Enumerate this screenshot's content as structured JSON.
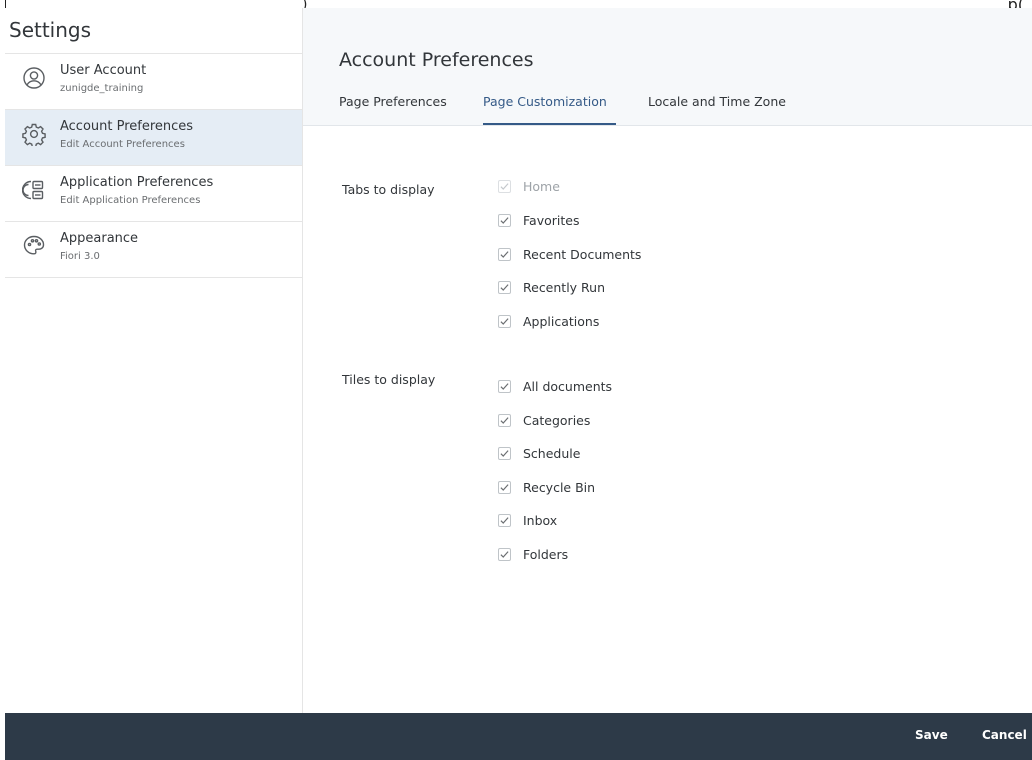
{
  "sidebar": {
    "title": "Settings",
    "items": [
      {
        "label": "User Account",
        "sub": "zunigde_training",
        "icon": "user-icon"
      },
      {
        "label": "Account Preferences",
        "sub": "Edit Account Preferences",
        "icon": "gear-icon"
      },
      {
        "label": "Application Preferences",
        "sub": "Edit Application Preferences",
        "icon": "app-settings-icon"
      },
      {
        "label": "Appearance",
        "sub": "Fiori 3.0",
        "icon": "palette-icon"
      }
    ],
    "selected_index": 1
  },
  "header": {
    "title": "Account Preferences",
    "tabs": [
      {
        "label": "Page Preferences"
      },
      {
        "label": "Page Customization"
      },
      {
        "label": "Locale and Time Zone"
      }
    ],
    "active_tab_index": 1
  },
  "content": {
    "tabs_group": {
      "label": "Tabs to display",
      "options": [
        {
          "label": "Home",
          "checked": true,
          "disabled": true
        },
        {
          "label": "Favorites",
          "checked": true,
          "disabled": false
        },
        {
          "label": "Recent Documents",
          "checked": true,
          "disabled": false
        },
        {
          "label": "Recently Run",
          "checked": true,
          "disabled": false
        },
        {
          "label": "Applications",
          "checked": true,
          "disabled": false
        }
      ]
    },
    "tiles_group": {
      "label": "Tiles to display",
      "options": [
        {
          "label": "All documents",
          "checked": true
        },
        {
          "label": "Categories",
          "checked": true
        },
        {
          "label": "Schedule",
          "checked": true
        },
        {
          "label": "Recycle Bin",
          "checked": true
        },
        {
          "label": "Inbox",
          "checked": true
        },
        {
          "label": "Folders",
          "checked": true
        }
      ]
    }
  },
  "footer": {
    "save_label": "Save",
    "cancel_label": "Cancel"
  },
  "colors": {
    "accent": "#355a87",
    "selected_bg": "#e5edf5",
    "footer_bg": "#2d3a48",
    "header_bg": "#f6f8fa"
  }
}
